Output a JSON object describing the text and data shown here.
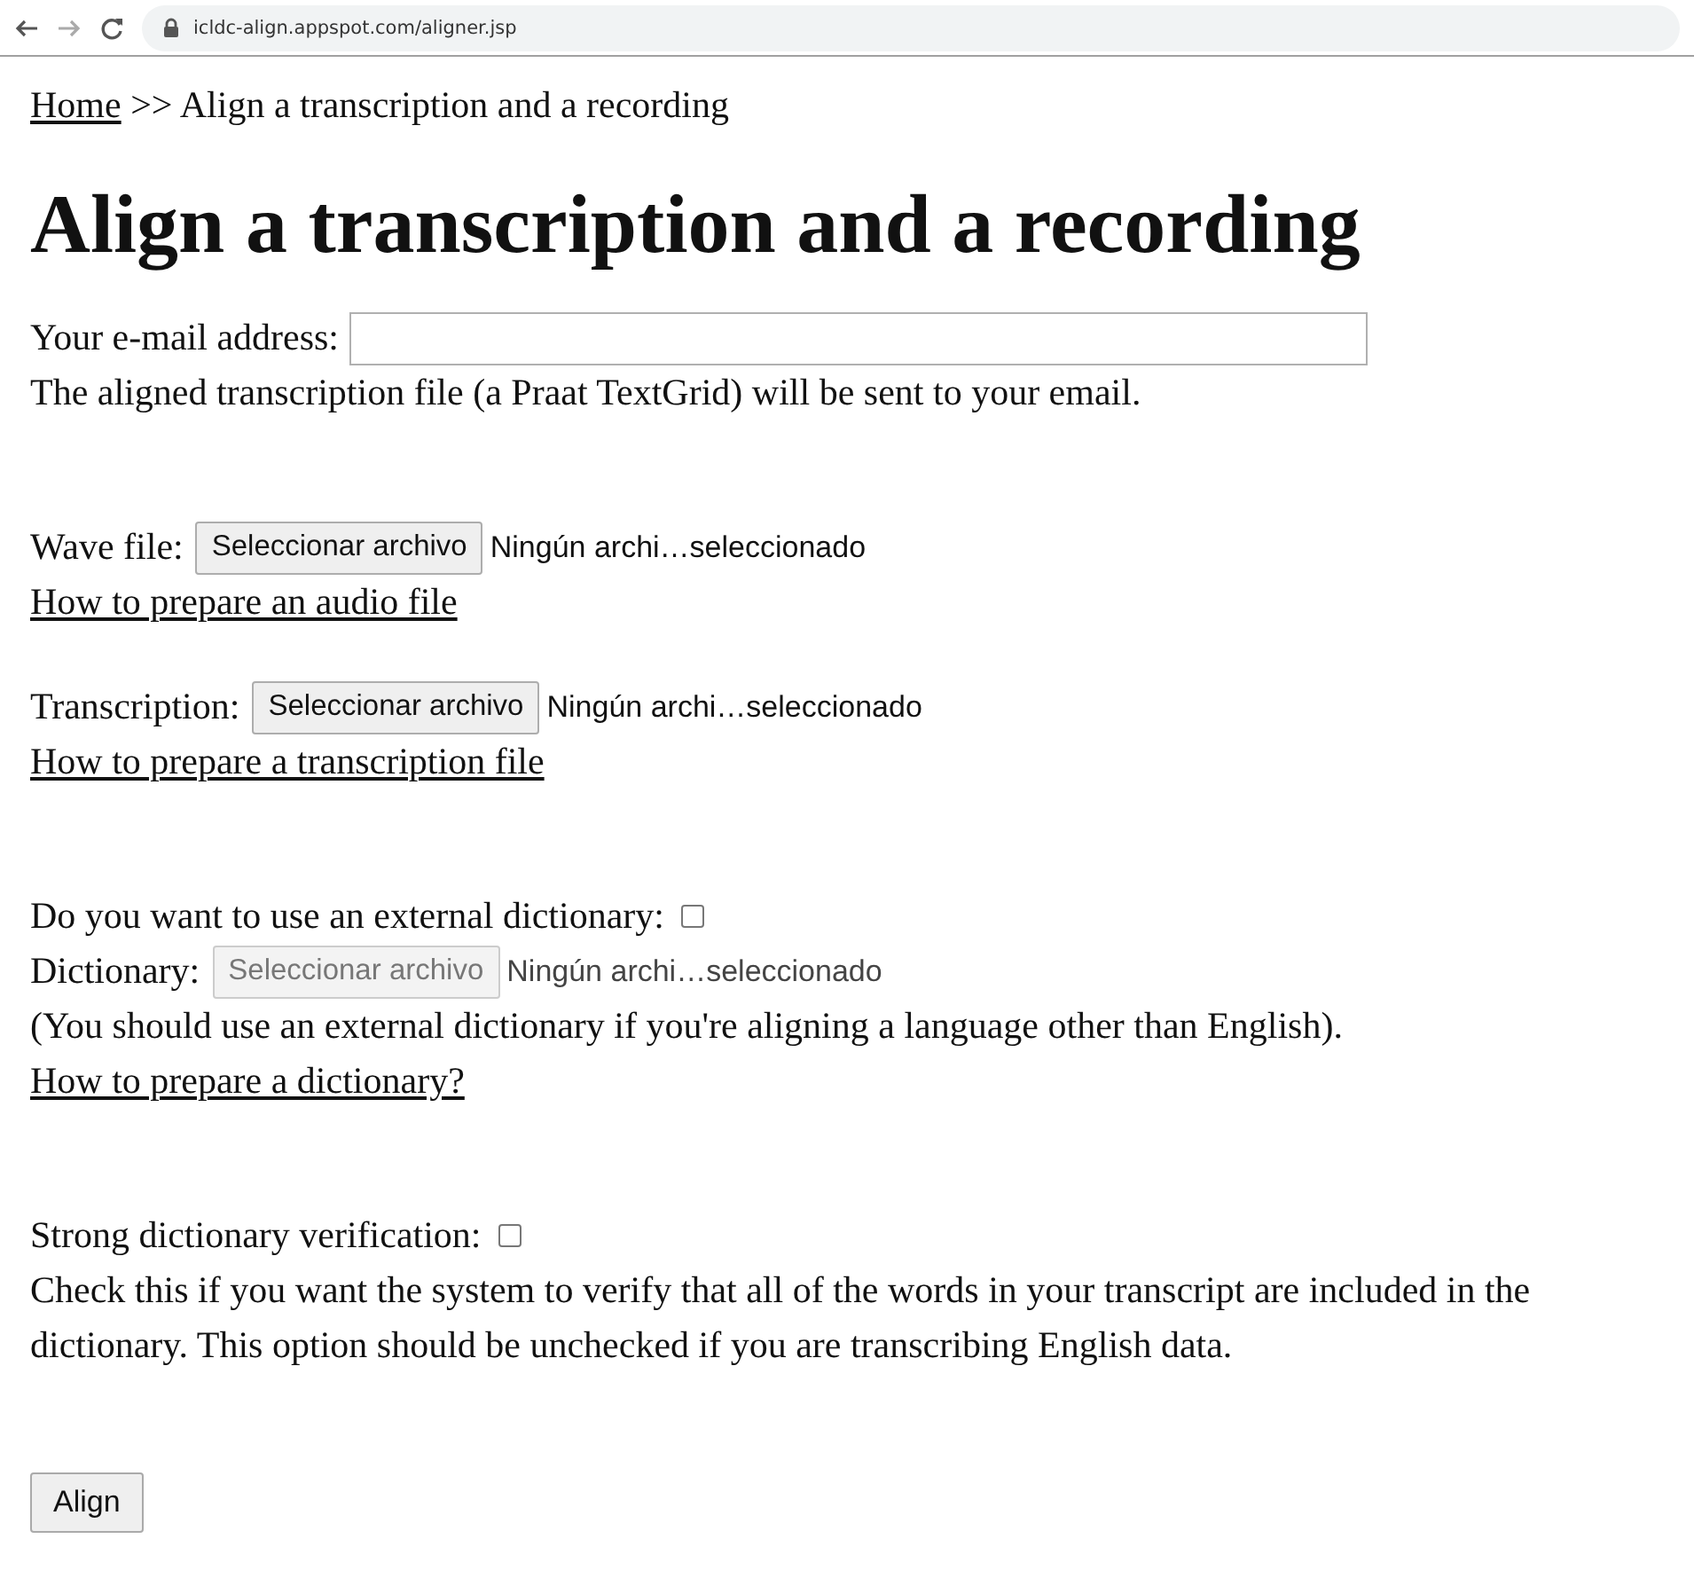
{
  "browser": {
    "url": "icldc-align.appspot.com/aligner.jsp"
  },
  "breadcrumb": {
    "link": "Home",
    "separator": ">>",
    "current": "Align a transcription and a recording"
  },
  "heading": "Align a transcription and a recording",
  "sections": [
    {
      "paragraphs": [
        [
          {
            "kind": "email",
            "label": "Your e-mail address:"
          },
          {
            "kind": "text",
            "text": "The aligned transcription file (a Praat TextGrid) will be sent to your email."
          }
        ]
      ]
    },
    {
      "paragraphs": [
        [
          {
            "kind": "file",
            "label": "Wave file:",
            "button": "Seleccionar archivo",
            "status": "Ningún archi…seleccionado",
            "disabled": false
          },
          {
            "kind": "link",
            "text": "How to prepare an audio file"
          }
        ],
        [
          {
            "kind": "file",
            "label": "Transcription:",
            "button": "Seleccionar archivo",
            "status": "Ningún archi…seleccionado",
            "disabled": false
          },
          {
            "kind": "link",
            "text": "How to prepare a transcription file"
          }
        ]
      ]
    },
    {
      "paragraphs": [
        [
          {
            "kind": "checkbox",
            "label": "Do you want to use an external dictionary:",
            "checked": false
          },
          {
            "kind": "file",
            "label": "Dictionary:",
            "button": "Seleccionar archivo",
            "status": "Ningún archi…seleccionado",
            "disabled": true
          },
          {
            "kind": "text",
            "text": "(You should use an external dictionary if you're aligning a language other than English)."
          },
          {
            "kind": "link",
            "text": "How to prepare a dictionary?"
          }
        ]
      ]
    },
    {
      "paragraphs": [
        [
          {
            "kind": "checkbox",
            "label": "Strong dictionary verification:",
            "checked": false
          },
          {
            "kind": "text",
            "text": "Check this if you want the system to verify that all of the words in your transcript are included in the dictionary. This option should be unchecked if you are transcribing English data."
          }
        ]
      ]
    }
  ],
  "submit": "Align"
}
